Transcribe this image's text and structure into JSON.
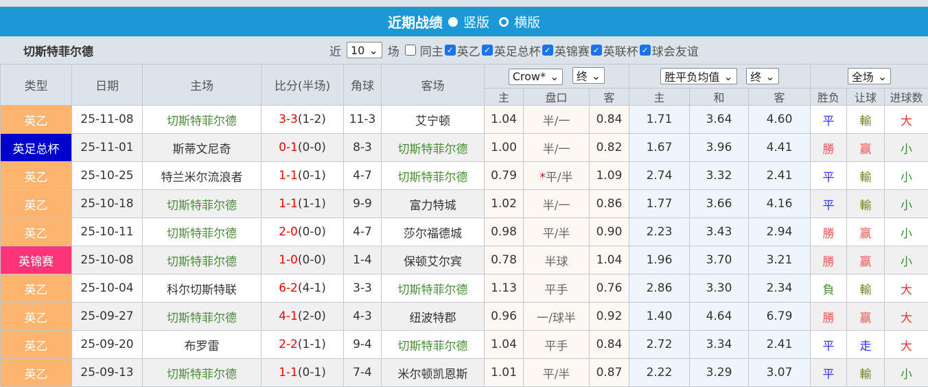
{
  "title": {
    "text": "近期战绩",
    "opt1": "竖版",
    "opt2": "横版",
    "opt1_selected": true
  },
  "filter": {
    "team": "切斯特菲尔德",
    "near": "近",
    "count": "10",
    "unit": "场",
    "same_home": "同主",
    "leagues": [
      "英乙",
      "英足总杯",
      "英锦赛",
      "英联杯",
      "球会友谊"
    ]
  },
  "headers": {
    "type": "类型",
    "date": "日期",
    "home": "主场",
    "score": "比分(半场)",
    "corner": "角球",
    "away": "客场",
    "company": "Crow*",
    "final1": "终",
    "avg": "胜平负均值",
    "final2": "终",
    "scope": "全场",
    "sub": {
      "h": "主",
      "line": "盘口",
      "a": "客",
      "h2": "主",
      "d": "和",
      "a2": "客",
      "wl": "胜负",
      "hc": "让球",
      "ou": "进球数"
    }
  },
  "colors": {
    "英乙": "#fdb46f",
    "英足总杯": "#0000cc",
    "英锦赛": "#ff3377",
    "title_bar": "#1a99d6"
  },
  "rows": [
    {
      "type": "英乙",
      "date": "25-11-08",
      "home": "切斯特菲尔德",
      "hg": true,
      "score": "3-3",
      "half": "(1-2)",
      "corner": "11-3",
      "away": "艾宁顿",
      "ag": false,
      "oh": "1.04",
      "star": "",
      "line": "半/一",
      "oa": "0.84",
      "w": "1.71",
      "d": "3.64",
      "l": "4.60",
      "wl": "平",
      "hc": "輸",
      "ou": "大"
    },
    {
      "type": "英足总杯",
      "date": "25-11-01",
      "home": "斯蒂文尼奇",
      "hg": false,
      "score": "0-1",
      "half": "(0-0)",
      "corner": "8-3",
      "away": "切斯特菲尔德",
      "ag": true,
      "oh": "1.00",
      "star": "",
      "line": "半/一",
      "oa": "0.82",
      "w": "1.67",
      "d": "3.96",
      "l": "4.41",
      "wl": "勝",
      "hc": "赢",
      "ou": "小"
    },
    {
      "type": "英乙",
      "date": "25-10-25",
      "home": "特兰米尔流浪者",
      "hg": false,
      "score": "1-1",
      "half": "(0-1)",
      "corner": "4-7",
      "away": "切斯特菲尔德",
      "ag": true,
      "oh": "0.79",
      "star": "*",
      "line": "平/半",
      "oa": "1.09",
      "w": "2.74",
      "d": "3.32",
      "l": "2.41",
      "wl": "平",
      "hc": "輸",
      "ou": "小"
    },
    {
      "type": "英乙",
      "date": "25-10-18",
      "home": "切斯特菲尔德",
      "hg": true,
      "score": "1-1",
      "half": "(1-1)",
      "corner": "9-9",
      "away": "富力特城",
      "ag": false,
      "oh": "1.02",
      "star": "",
      "line": "半/一",
      "oa": "0.86",
      "w": "1.77",
      "d": "3.66",
      "l": "4.16",
      "wl": "平",
      "hc": "輸",
      "ou": "小"
    },
    {
      "type": "英乙",
      "date": "25-10-11",
      "home": "切斯特菲尔德",
      "hg": true,
      "score": "2-0",
      "half": "(0-0)",
      "corner": "4-7",
      "away": "莎尔福德城",
      "ag": false,
      "oh": "0.98",
      "star": "",
      "line": "平/半",
      "oa": "0.90",
      "w": "2.23",
      "d": "3.43",
      "l": "2.94",
      "wl": "勝",
      "hc": "赢",
      "ou": "小"
    },
    {
      "type": "英锦赛",
      "date": "25-10-08",
      "home": "切斯特菲尔德",
      "hg": true,
      "score": "1-0",
      "half": "(0-0)",
      "corner": "1-4",
      "away": "保顿艾尔宾",
      "ag": false,
      "oh": "0.78",
      "star": "",
      "line": "半球",
      "oa": "1.04",
      "w": "1.96",
      "d": "3.70",
      "l": "3.21",
      "wl": "勝",
      "hc": "赢",
      "ou": "小"
    },
    {
      "type": "英乙",
      "date": "25-10-04",
      "home": "科尔切斯特联",
      "hg": false,
      "score": "6-2",
      "half": "(4-1)",
      "corner": "3-3",
      "away": "切斯特菲尔德",
      "ag": true,
      "oh": "1.13",
      "star": "",
      "line": "平手",
      "oa": "0.76",
      "w": "2.86",
      "d": "3.30",
      "l": "2.34",
      "wl": "負",
      "hc": "輸",
      "ou": "大"
    },
    {
      "type": "英乙",
      "date": "25-09-27",
      "home": "切斯特菲尔德",
      "hg": true,
      "score": "4-1",
      "half": "(2-0)",
      "corner": "4-3",
      "away": "纽波特郡",
      "ag": false,
      "oh": "0.96",
      "star": "",
      "line": "一/球半",
      "oa": "0.92",
      "w": "1.40",
      "d": "4.64",
      "l": "6.79",
      "wl": "勝",
      "hc": "赢",
      "ou": "大"
    },
    {
      "type": "英乙",
      "date": "25-09-20",
      "home": "布罗雷",
      "hg": false,
      "score": "2-2",
      "half": "(1-1)",
      "corner": "9-4",
      "away": "切斯特菲尔德",
      "ag": true,
      "oh": "1.04",
      "star": "",
      "line": "平手",
      "oa": "0.84",
      "w": "2.72",
      "d": "3.34",
      "l": "2.41",
      "wl": "平",
      "hc": "走",
      "ou": "大"
    },
    {
      "type": "英乙",
      "date": "25-09-13",
      "home": "切斯特菲尔德",
      "hg": true,
      "score": "1-1",
      "half": "(0-1)",
      "corner": "7-4",
      "away": "米尔顿凯恩斯",
      "ag": false,
      "oh": "1.01",
      "star": "",
      "line": "平/半",
      "oa": "0.87",
      "w": "2.22",
      "d": "3.29",
      "l": "3.07",
      "wl": "平",
      "hc": "輸",
      "ou": "小"
    }
  ]
}
